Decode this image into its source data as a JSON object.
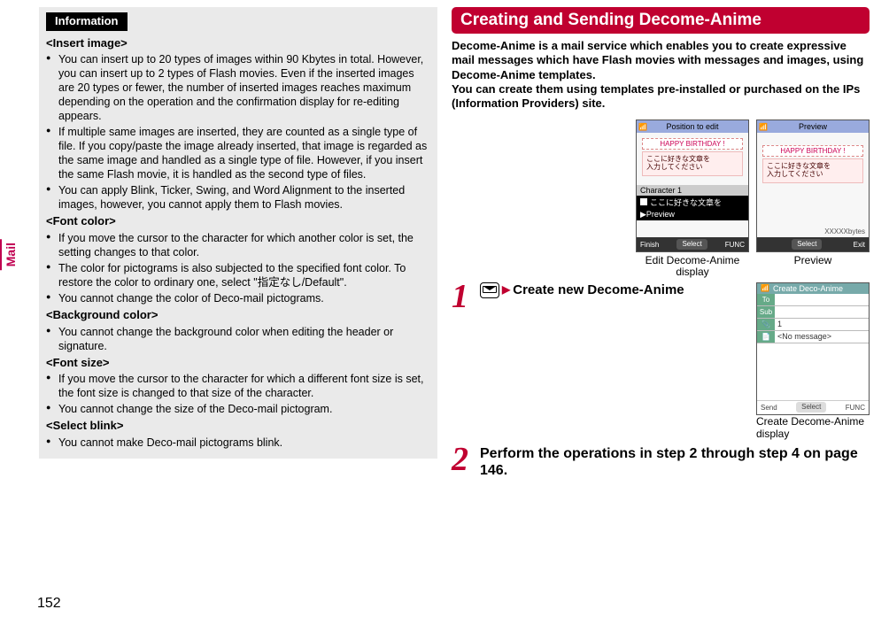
{
  "sideTab": "Mail",
  "pageNumber": "152",
  "leftColumn": {
    "infoLabel": "Information",
    "sections": {
      "insertImage": {
        "heading": "<Insert image>",
        "items": [
          "You can insert up to 20 types of images within 90 Kbytes in total. However, you can insert up to 2 types of Flash movies. Even if the inserted images are 20 types or fewer, the number of inserted images reaches maximum depending on the operation and the confirmation display for re-editing appears.",
          "If multiple same images are inserted, they are counted as a single type of file. If you copy/paste the image already inserted, that image is regarded as the same image and handled as a single type of file. However, if you insert the same Flash movie, it is handled as the second type of files.",
          "You can apply Blink, Ticker, Swing, and Word Alignment to the inserted images, however, you cannot apply them to Flash movies."
        ]
      },
      "fontColor": {
        "heading": "<Font color>",
        "items": [
          "If you move the cursor to the character for which another color is set, the setting changes to that color.",
          "The color for pictograms is also subjected to the specified font color. To restore the color to ordinary one, select \"指定なし/Default\".",
          "You cannot change the color of Deco-mail pictograms."
        ]
      },
      "bgColor": {
        "heading": "<Background color>",
        "items": [
          "You cannot change the background color when editing the header or signature."
        ]
      },
      "fontSize": {
        "heading": "<Font size>",
        "items": [
          "If you move the cursor to the character for which a different font size is set, the font size is changed to that size of the character.",
          "You cannot change the size of the Deco-mail pictogram."
        ]
      },
      "selectBlink": {
        "heading": "<Select blink>",
        "items": [
          "You cannot make Deco-mail pictograms blink."
        ]
      }
    }
  },
  "rightColumn": {
    "redBar": "Creating and Sending Decome-Anime",
    "desc": "Decome-Anime is a mail service which enables you to create expressive mail messages which have Flash movies with messages and images, using Decome-Anime templates.\nYou can create them using templates pre-installed or purchased on the IPs (Information Providers) site.",
    "screens": {
      "edit": {
        "statusTitle": "Position to edit",
        "bannerText": "HAPPY BIRTHDAY !",
        "jpText": "ここに好きな文章を\n入力してください",
        "charLabel": "Character 1",
        "highlightText": "ここに好きな文章を",
        "previewLabel": "Preview",
        "softLeft": "Finish",
        "softMid": "Select",
        "softRight": "FUNC",
        "caption": "Edit Decome-Anime display"
      },
      "preview": {
        "statusTitle": "Preview",
        "bannerText": "HAPPY BIRTHDAY !",
        "jpText": "ここに好きな文章を\n入力してください",
        "bytes": "XXXXXbytes",
        "softLeft": "",
        "softMid": "Select",
        "softRight": "Exit",
        "caption": "Preview"
      },
      "compose": {
        "topTitle": "Create Deco-Anime",
        "toLabel": "To",
        "subLabel": "Sub",
        "row1Label": "1",
        "row2Label": "",
        "row2Text": "<No message>",
        "softLeft": "Send",
        "softMid": "Select",
        "softRight": "FUNC",
        "caption": "Create Decome-Anime display"
      }
    },
    "steps": {
      "s1": {
        "num": "1",
        "text": "Create new Decome-Anime"
      },
      "s2": {
        "num": "2",
        "text": "Perform the operations in step 2 through step 4 on page 146."
      }
    }
  }
}
